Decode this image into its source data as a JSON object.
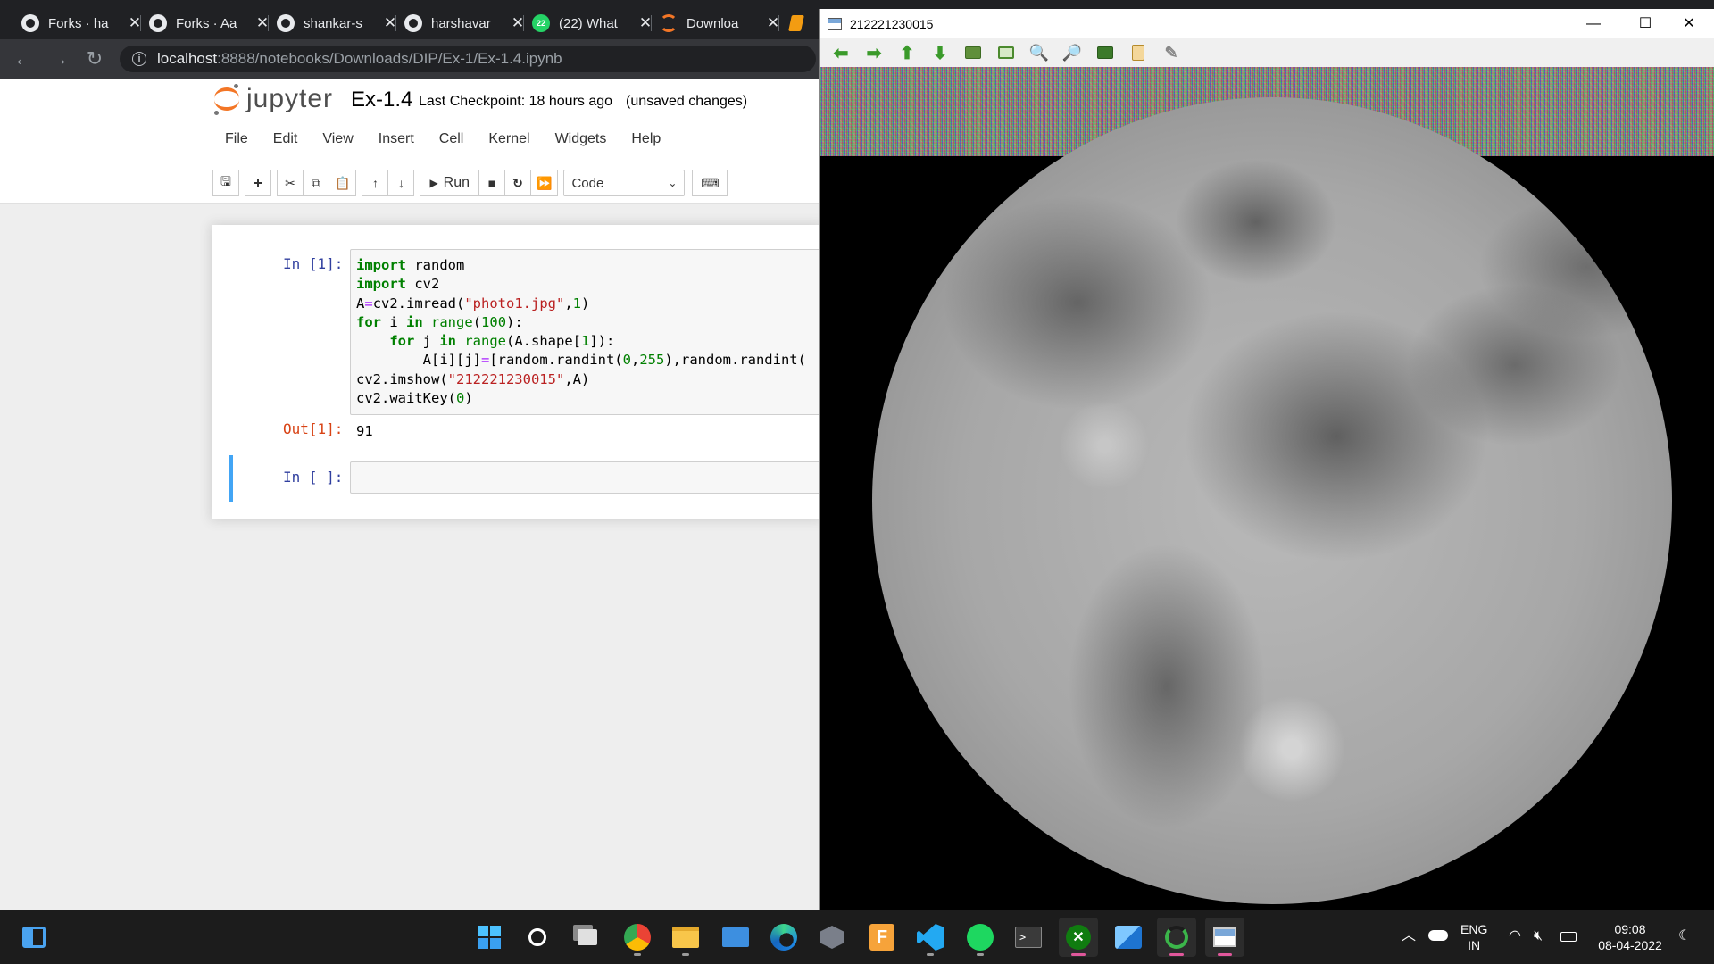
{
  "browser": {
    "tabs": [
      {
        "title": "Forks · ha",
        "icon": "github-icon"
      },
      {
        "title": "Forks · Aa",
        "icon": "github-icon"
      },
      {
        "title": "shankar-s",
        "icon": "github-icon"
      },
      {
        "title": "harshavar",
        "icon": "github-icon"
      },
      {
        "title": "(22) What",
        "icon": "whatsapp-icon",
        "badge": "22"
      },
      {
        "title": "Downloa",
        "icon": "jupyter-icon"
      }
    ],
    "url_host": "localhost",
    "url_path": ":8888/notebooks/Downloads/DIP/Ex-1/Ex-1.4.ipynb"
  },
  "jupyter": {
    "logo_text": "jupyter",
    "notebook_name": "Ex-1.4",
    "checkpoint": "Last Checkpoint: 18 hours ago",
    "status": "(unsaved changes)",
    "menu": [
      "File",
      "Edit",
      "View",
      "Insert",
      "Cell",
      "Kernel",
      "Widgets",
      "Help"
    ],
    "toolbar": {
      "run_label": "Run",
      "cell_type": "Code"
    },
    "cells": [
      {
        "in_prompt": "In [1]:",
        "code": [
          "import random",
          "import cv2",
          "A=cv2.imread(\"photo1.jpg\",1)",
          "for i in range(100):",
          "    for j in range(A.shape[1]):",
          "        A[i][j]=[random.randint(0,255),random.randint(",
          "cv2.imshow(\"212221230015\",A)",
          "cv2.waitKey(0)"
        ],
        "out_prompt": "Out[1]:",
        "output": "91"
      },
      {
        "in_prompt": "In [ ]:",
        "code": []
      }
    ]
  },
  "cv_window": {
    "title": "212221230015",
    "controls": {
      "minimize": "—",
      "maximize": "☐",
      "close": "✕"
    }
  },
  "taskbar": {
    "lang_top": "ENG",
    "lang_bottom": "IN",
    "time": "09:08",
    "date": "08-04-2022"
  }
}
